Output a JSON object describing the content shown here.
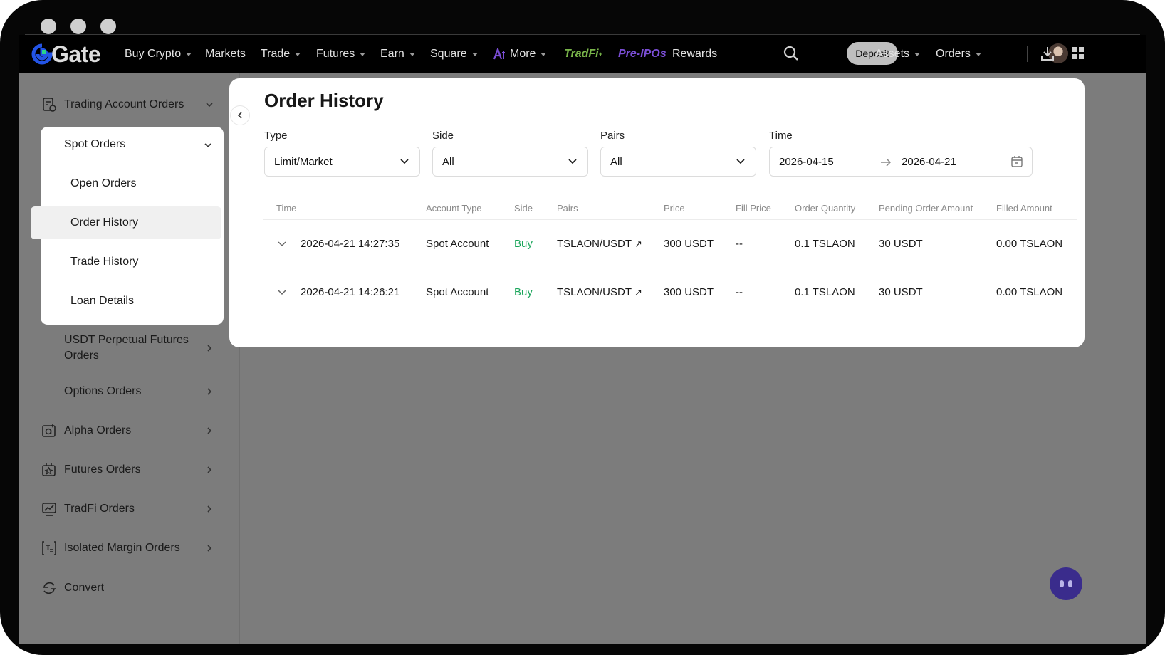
{
  "nav": {
    "logo_text": "Gate",
    "items": [
      "Buy Crypto",
      "Markets",
      "Trade",
      "Futures",
      "Earn",
      "Square",
      "More",
      "TradFi",
      "Pre-IPOs",
      "Rewards"
    ],
    "deposit": "Deposit",
    "assets": "Assets",
    "orders": "Orders"
  },
  "sidebar": {
    "trading_account_orders": "Trading Account Orders",
    "spot_orders": "Spot Orders",
    "spot_sub": [
      "Open Orders",
      "Order History",
      "Trade History",
      "Loan Details"
    ],
    "usdt_perp": "USDT Perpetual Futures Orders",
    "options": "Options Orders",
    "alpha": "Alpha Orders",
    "futures": "Futures Orders",
    "tradfi": "TradFi Orders",
    "isolated": "Isolated Margin Orders",
    "convert": "Convert"
  },
  "main": {
    "title": "Order History",
    "filters": {
      "type_label": "Type",
      "type_value": "Limit/Market",
      "side_label": "Side",
      "side_value": "All",
      "pairs_label": "Pairs",
      "pairs_value": "All",
      "time_label": "Time",
      "time_start": "2026-04-15",
      "time_end": "2026-04-21"
    },
    "columns": [
      "Time",
      "Account Type",
      "Side",
      "Pairs",
      "Price",
      "Fill Price",
      "Order Quantity",
      "Pending Order Amount",
      "Filled Amount"
    ],
    "rows": [
      {
        "time": "2026-04-21 14:27:35",
        "account": "Spot Account",
        "side": "Buy",
        "pair": "TSLAON/USDT",
        "price": "300 USDT",
        "fill": "--",
        "qty": "0.1 TSLAON",
        "pending": "30 USDT",
        "filled": "0.00 TSLAON"
      },
      {
        "time": "2026-04-21 14:26:21",
        "account": "Spot Account",
        "side": "Buy",
        "pair": "TSLAON/USDT",
        "price": "300 USDT",
        "fill": "--",
        "qty": "0.1 TSLAON",
        "pending": "30 USDT",
        "filled": "0.00 TSLAON"
      }
    ]
  },
  "colors": {
    "buy": "#19a55a",
    "brand_blue": "#2354e6",
    "tradfi_green": "#79b54a",
    "preipo_purple": "#7b4ed6"
  }
}
